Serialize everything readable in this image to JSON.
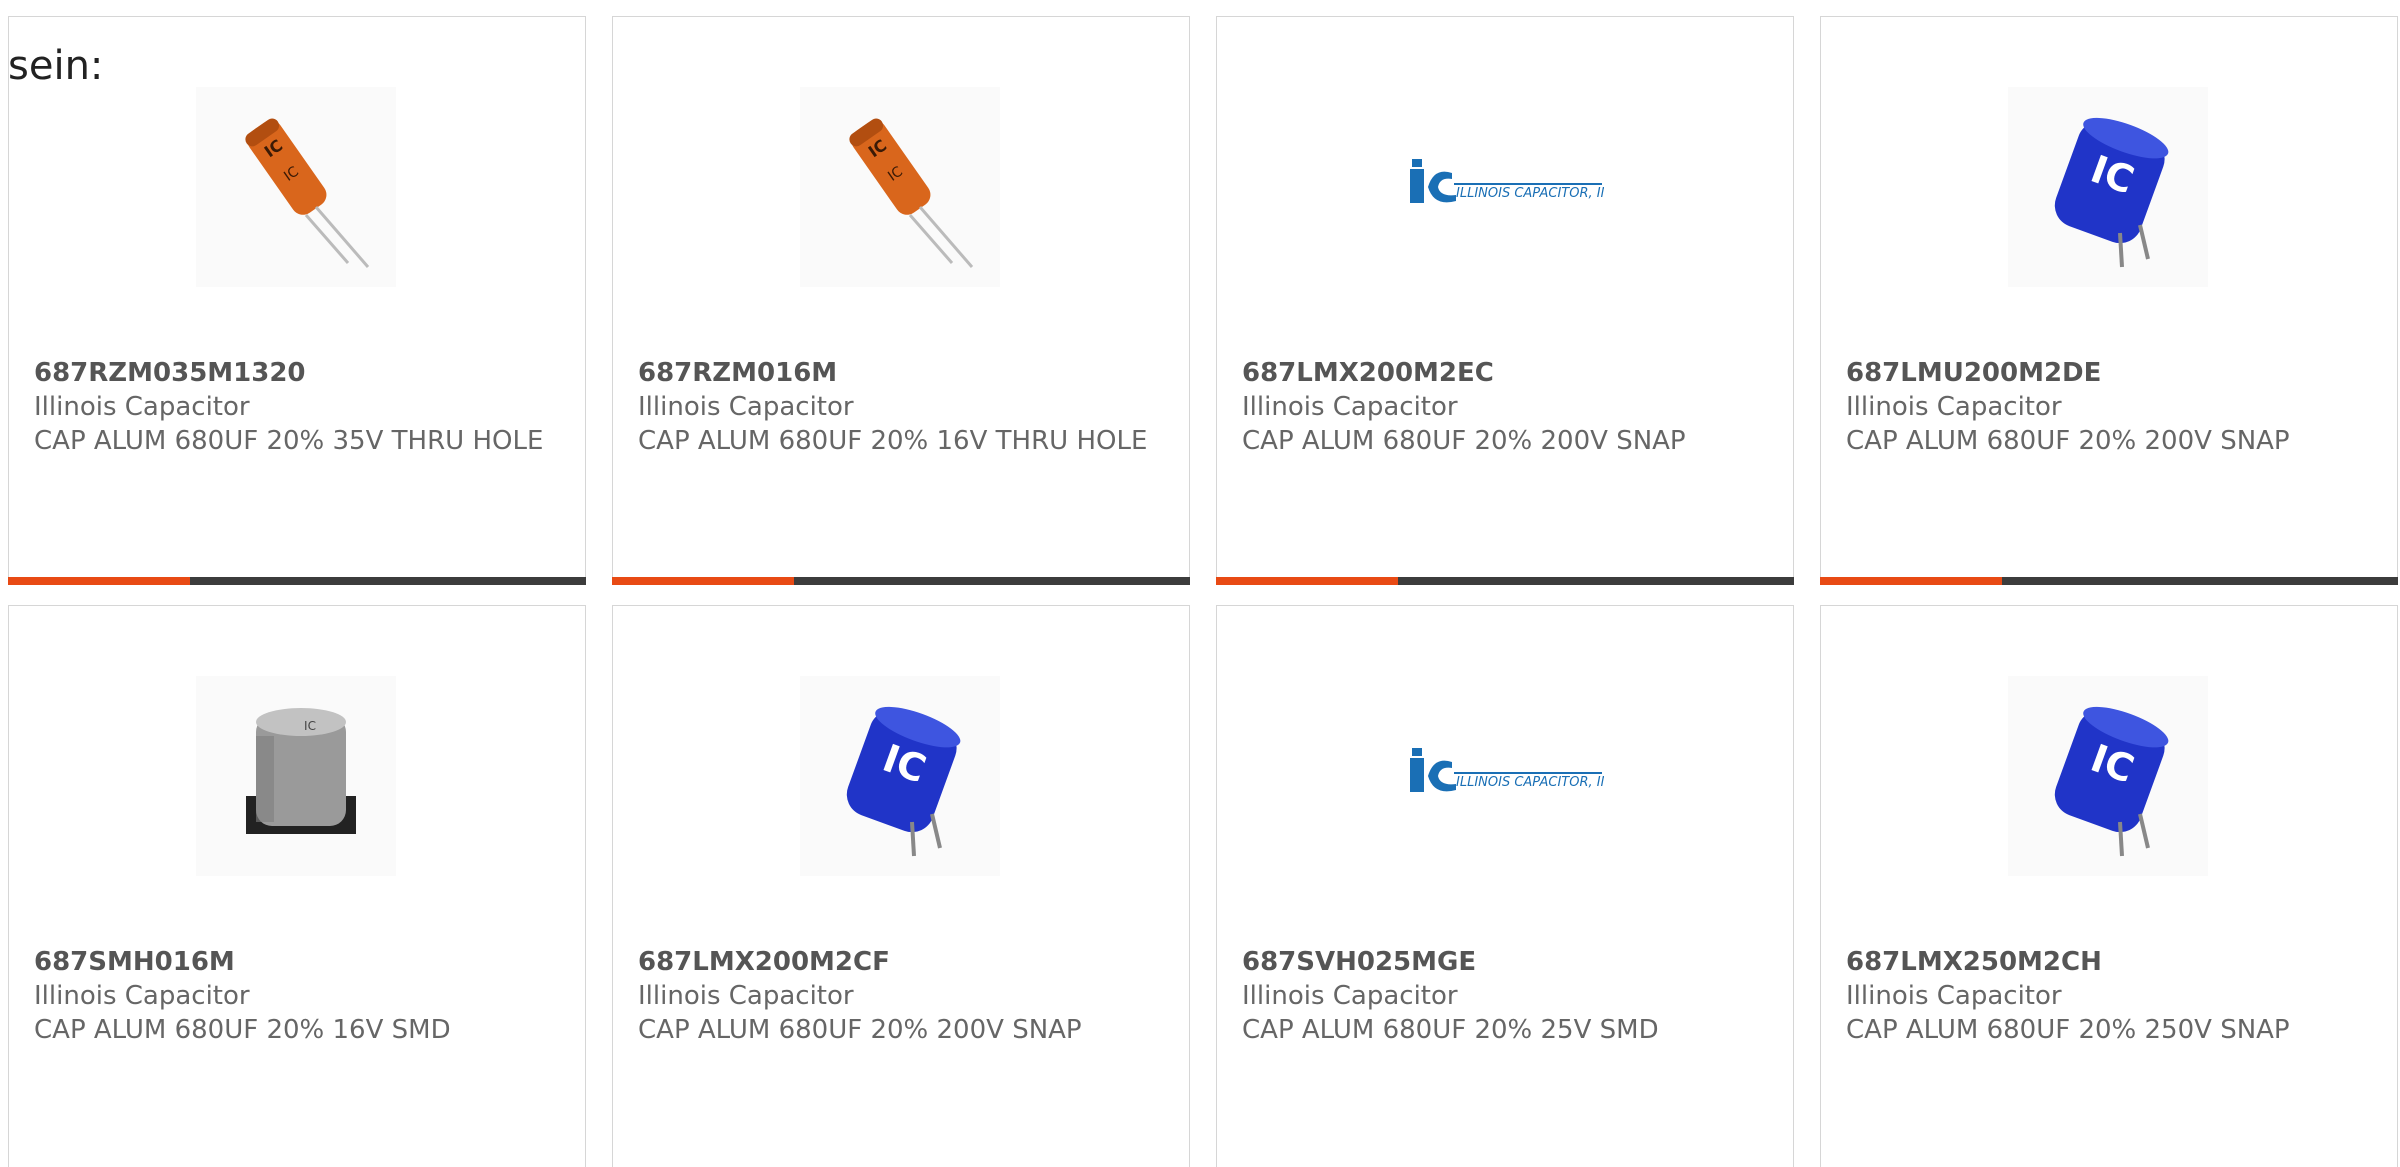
{
  "intro_text": "sein:",
  "colors": {
    "accent": "#e84a14",
    "bar": "#3c3c3c",
    "border": "#d6d6d6",
    "text": "#666666"
  },
  "products": [
    {
      "part_number": "687RZM035M1320",
      "manufacturer": "Illinois Capacitor",
      "description": "CAP ALUM 680UF 20% 35V THRU HOLE",
      "image": "radial-capacitor-orange"
    },
    {
      "part_number": "687RZM016M",
      "manufacturer": "Illinois Capacitor",
      "description": "CAP ALUM 680UF 20% 16V THRU HOLE",
      "image": "radial-capacitor-orange"
    },
    {
      "part_number": "687LMX200M2EC",
      "manufacturer": "Illinois Capacitor",
      "description": "CAP ALUM 680UF 20% 200V SNAP",
      "image": "illinois-capacitor-logo",
      "logo_text": "ILLINOIS CAPACITOR, INC."
    },
    {
      "part_number": "687LMU200M2DE",
      "manufacturer": "Illinois Capacitor",
      "description": "CAP ALUM 680UF 20% 200V SNAP",
      "image": "snap-in-capacitor-blue"
    },
    {
      "part_number": "687SMH016M",
      "manufacturer": "Illinois Capacitor",
      "description": "CAP ALUM 680UF 20% 16V SMD",
      "image": "smd-capacitor-silver"
    },
    {
      "part_number": "687LMX200M2CF",
      "manufacturer": "Illinois Capacitor",
      "description": "CAP ALUM 680UF 20% 200V SNAP",
      "image": "snap-in-capacitor-blue"
    },
    {
      "part_number": "687SVH025MGE",
      "manufacturer": "Illinois Capacitor",
      "description": "CAP ALUM 680UF 20% 25V SMD",
      "image": "illinois-capacitor-logo",
      "logo_text": "ILLINOIS CAPACITOR, INC."
    },
    {
      "part_number": "687LMX250M2CH",
      "manufacturer": "Illinois Capacitor",
      "description": "CAP ALUM 680UF 20% 250V SNAP",
      "image": "snap-in-capacitor-blue"
    }
  ]
}
